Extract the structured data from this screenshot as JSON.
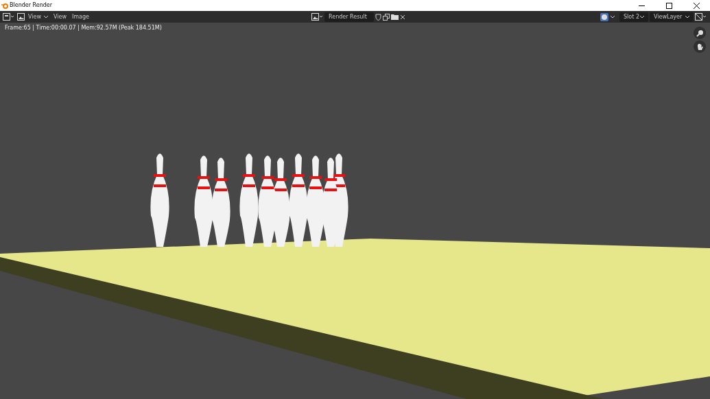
{
  "window": {
    "title": "Blender Render"
  },
  "header": {
    "view_mode": "View",
    "menus": [
      {
        "label": "View"
      },
      {
        "label": "Image"
      }
    ],
    "image_name": "Render Result",
    "slot": "Slot 2",
    "view_layer": "ViewLayer"
  },
  "viewport": {
    "info": "Frame:65 | Time:00:00.07 | Mem:92.57M (Peak 184.51M)"
  }
}
